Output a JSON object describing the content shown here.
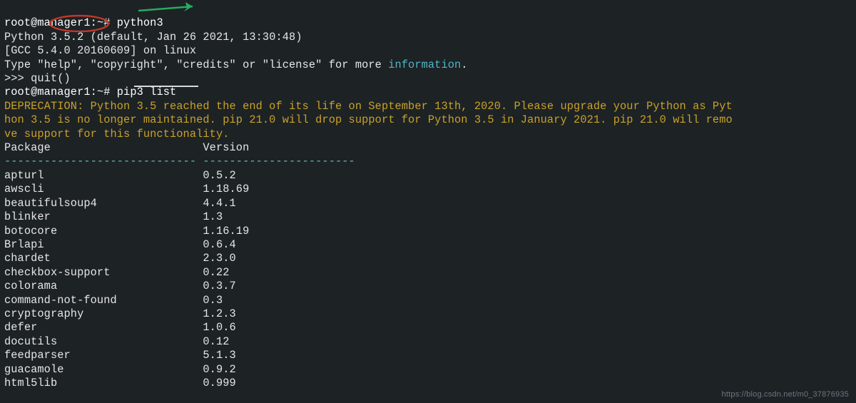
{
  "prompt1": {
    "user": "root",
    "at": "@",
    "host": "manager1",
    "colon": ":",
    "path": "~",
    "hash": "# "
  },
  "cmd1": "python3",
  "python_prefix": "Python ",
  "python_version": "3.5.2",
  "python_rest": " (default, Jan 26 2021, 13:30:48)",
  "gcc_line": "[GCC 5.4.0 20160609] on linux",
  "help_pre": "Type \"help\", \"copyright\", \"credits\" or \"license\" for more ",
  "help_info": "information",
  "help_dot": ".",
  "py_prompt": ">>> ",
  "quit": "quit()",
  "cmd2": "pip3 list",
  "deprecation": "DEPRECATION: Python 3.5 reached the end of its life on September 13th, 2020. Please upgrade your Python as Pyt\nhon 3.5 is no longer maintained. pip 21.0 will drop support for Python 3.5 in January 2021. pip 21.0 will remo\nve support for this functionality.",
  "header_pkg": "Package                       Version",
  "header_dash": "----------------------------- -----------------------",
  "packages": [
    {
      "name": "apturl",
      "version": "0.5.2"
    },
    {
      "name": "awscli",
      "version": "1.18.69"
    },
    {
      "name": "beautifulsoup4",
      "version": "4.4.1"
    },
    {
      "name": "blinker",
      "version": "1.3"
    },
    {
      "name": "botocore",
      "version": "1.16.19"
    },
    {
      "name": "Brlapi",
      "version": "0.6.4"
    },
    {
      "name": "chardet",
      "version": "2.3.0"
    },
    {
      "name": "checkbox-support",
      "version": "0.22"
    },
    {
      "name": "colorama",
      "version": "0.3.7"
    },
    {
      "name": "command-not-found",
      "version": "0.3"
    },
    {
      "name": "cryptography",
      "version": "1.2.3"
    },
    {
      "name": "defer",
      "version": "1.0.6"
    },
    {
      "name": "docutils",
      "version": "0.12"
    },
    {
      "name": "feedparser",
      "version": "5.1.3"
    },
    {
      "name": "guacamole",
      "version": "0.9.2"
    },
    {
      "name": "html5lib",
      "version": "0.999"
    }
  ],
  "watermark": "https://blog.csdn.net/m0_37876935",
  "chart_data": {
    "type": "table",
    "title": "pip3 list output",
    "columns": [
      "Package",
      "Version"
    ],
    "rows": [
      [
        "apturl",
        "0.5.2"
      ],
      [
        "awscli",
        "1.18.69"
      ],
      [
        "beautifulsoup4",
        "4.4.1"
      ],
      [
        "blinker",
        "1.3"
      ],
      [
        "botocore",
        "1.16.19"
      ],
      [
        "Brlapi",
        "0.6.4"
      ],
      [
        "chardet",
        "2.3.0"
      ],
      [
        "checkbox-support",
        "0.22"
      ],
      [
        "colorama",
        "0.3.7"
      ],
      [
        "command-not-found",
        "0.3"
      ],
      [
        "cryptography",
        "1.2.3"
      ],
      [
        "defer",
        "1.0.6"
      ],
      [
        "docutils",
        "0.12"
      ],
      [
        "feedparser",
        "5.1.3"
      ],
      [
        "guacamole",
        "0.9.2"
      ],
      [
        "html5lib",
        "0.999"
      ]
    ]
  }
}
